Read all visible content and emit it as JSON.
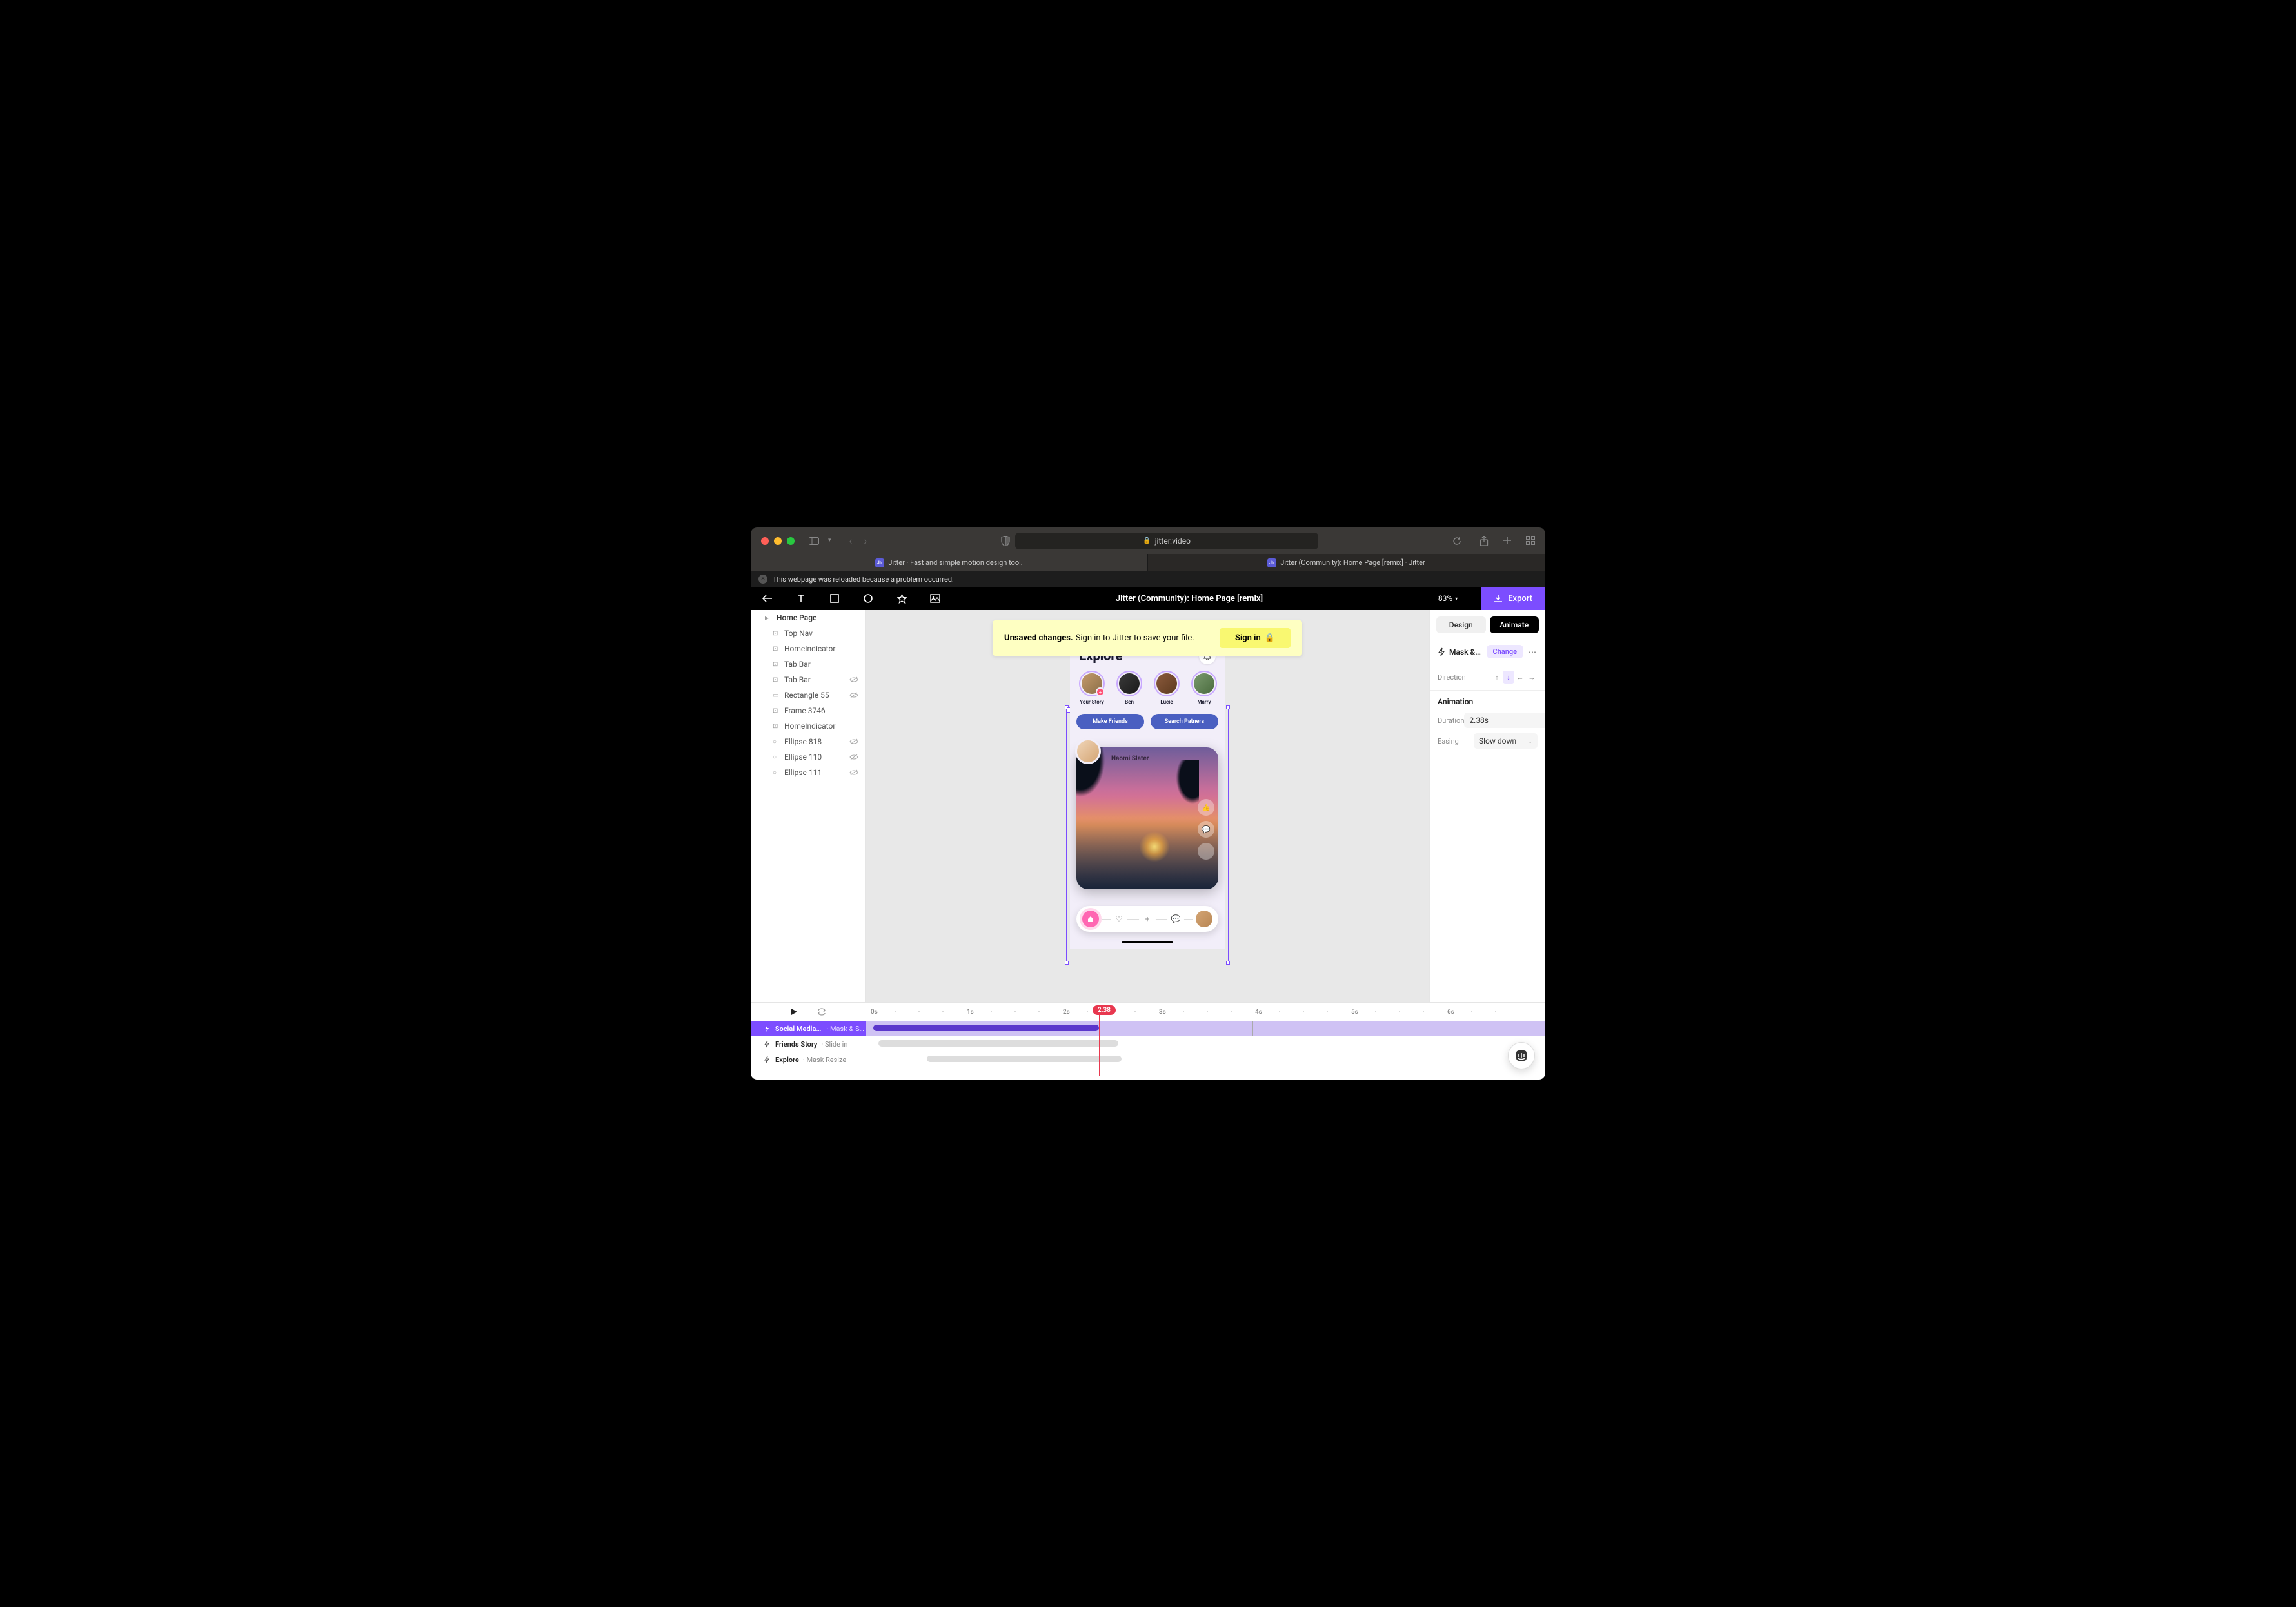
{
  "browser": {
    "url": "jitter.video",
    "tabs": [
      {
        "title": "Jitter · Fast and simple motion design tool."
      },
      {
        "title": "Jitter (Community): Home Page [remix] · Jitter"
      }
    ],
    "message": "This webpage was reloaded because a problem occurred."
  },
  "app": {
    "title": "Jitter (Community): Home Page [remix]",
    "zoom": "83%",
    "export_label": "Export"
  },
  "banner": {
    "strong": "Unsaved changes.",
    "text": "Sign in to Jitter to save your file.",
    "button": "Sign in"
  },
  "layers": [
    {
      "name": "Home Page",
      "root": true
    },
    {
      "name": "Top Nav"
    },
    {
      "name": "HomeIndicator"
    },
    {
      "name": "Tab Bar"
    },
    {
      "name": "Tab Bar",
      "hidden": true
    },
    {
      "name": "Rectangle 55",
      "hidden": true
    },
    {
      "name": "Frame 3746"
    },
    {
      "name": "HomeIndicator"
    },
    {
      "name": "Ellipse 818",
      "hidden": true
    },
    {
      "name": "Ellipse 110",
      "hidden": true
    },
    {
      "name": "Ellipse 111",
      "hidden": true
    }
  ],
  "phone": {
    "title": "Explore",
    "stories": [
      "Your Story",
      "Ben",
      "Lucie",
      "Marry"
    ],
    "buttons": [
      "Make Friends",
      "Search Patners"
    ],
    "post_author": "Naomi Slater"
  },
  "inspector": {
    "tabs": {
      "design": "Design",
      "animate": "Animate"
    },
    "mask_label": "Mask & Slid…",
    "change": "Change",
    "direction_label": "Direction",
    "animation_title": "Animation",
    "duration_label": "Duration",
    "duration_value": "2.38s",
    "easing_label": "Easing",
    "easing_value": "Slow down"
  },
  "timeline": {
    "playhead": "2.38",
    "marks": [
      "0s",
      "1s",
      "2s",
      "3s",
      "4s",
      "5s",
      "6s"
    ],
    "tracks": [
      {
        "name": "Social Media …",
        "anim": "Mask & Sl…",
        "selected": true
      },
      {
        "name": "Friends Story",
        "anim": "Slide in"
      },
      {
        "name": "Explore",
        "anim": "Mask Resize"
      }
    ]
  }
}
